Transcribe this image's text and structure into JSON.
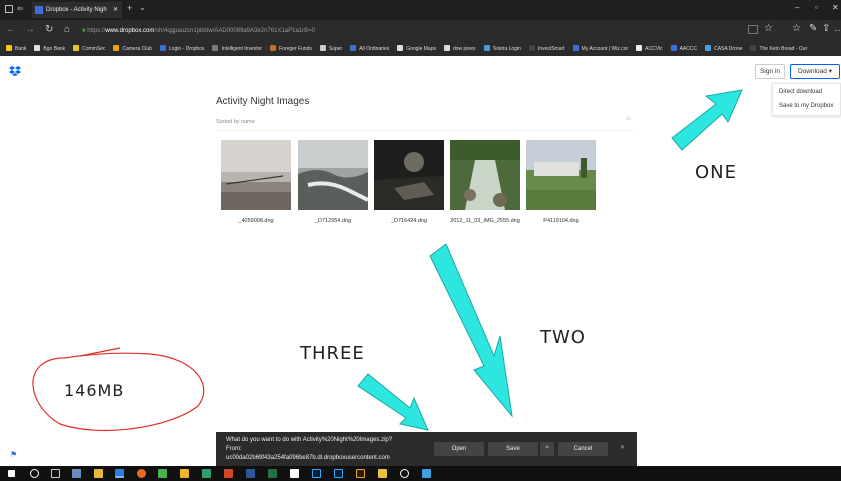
{
  "browser": {
    "tab_title": "Dropbox - Activity Nigh",
    "url_prefix": "https://",
    "url_domain": "www.dropbox.com",
    "url_path": "/sh/4qgpauzcn1pbbtw/AAD00089a9A3e2n761X1aP1a1rB=0",
    "favorites": [
      {
        "label": "Bank",
        "color": "#f5c518"
      },
      {
        "label": "Bgo Bank",
        "color": "#e0e0e0"
      },
      {
        "label": "CommSec",
        "color": "#f5c518"
      },
      {
        "label": "Camera Club",
        "color": "#f0a000"
      },
      {
        "label": "Login - Dropbox",
        "color": "#3d6fd8"
      },
      {
        "label": "Intelligent Investor",
        "color": "#7a7a7a"
      },
      {
        "label": "Foreger Funds",
        "color": "#c07020"
      },
      {
        "label": "Super",
        "color": "#cccccc"
      },
      {
        "label": "All Ordinaries",
        "color": "#3d6fd8"
      },
      {
        "label": "Google Maps",
        "color": "#dddddd"
      },
      {
        "label": "dow jones",
        "color": "#dddddd"
      },
      {
        "label": "Telstra Login",
        "color": "#3da0e0"
      },
      {
        "label": "InvestSmart",
        "color": "#444444"
      },
      {
        "label": "My Account | Wiz.cor",
        "color": "#3d6fd8"
      },
      {
        "label": "ACCVic",
        "color": "#eeeeee"
      },
      {
        "label": "AACCC",
        "color": "#3d6fd8"
      },
      {
        "label": "CASA Drone",
        "color": "#3da0e0"
      },
      {
        "label": "The Keto Bread - Our",
        "color": "#444444"
      }
    ]
  },
  "header": {
    "sign_in_label": "Sign in",
    "download_label": "Download ▾"
  },
  "download_menu": {
    "items": [
      "Direct download",
      "Save to my Dropbox"
    ]
  },
  "folder": {
    "title": "Activity Night Images",
    "sort_label": "Sorted by name",
    "files": [
      {
        "name": "_4059008.dng"
      },
      {
        "name": "_D712954.dng"
      },
      {
        "name": "_D716424.dng"
      },
      {
        "name": "2012_11_03_IMG_2555.dng"
      },
      {
        "name": "P4119104.dng"
      }
    ]
  },
  "annotations": {
    "one": "ONE",
    "two": "TWO",
    "three": "THREE",
    "size": "146MB"
  },
  "download_bar": {
    "question": "What do you want to do with Activity%20Night%20Images.zip?",
    "from_label": "From:",
    "from_host": "uc00da02b69f43a254fa096be87b.dl.dropboxusercontent.com",
    "open_label": "Open",
    "save_label": "Save",
    "more_label": "^",
    "cancel_label": "Cancel",
    "close_label": "✕"
  },
  "colors": {
    "arrow": "#2ee6e0",
    "circle": "#e0302a",
    "dropbox_blue": "#0061fe",
    "download_bar_bg": "#2b2b2b"
  }
}
